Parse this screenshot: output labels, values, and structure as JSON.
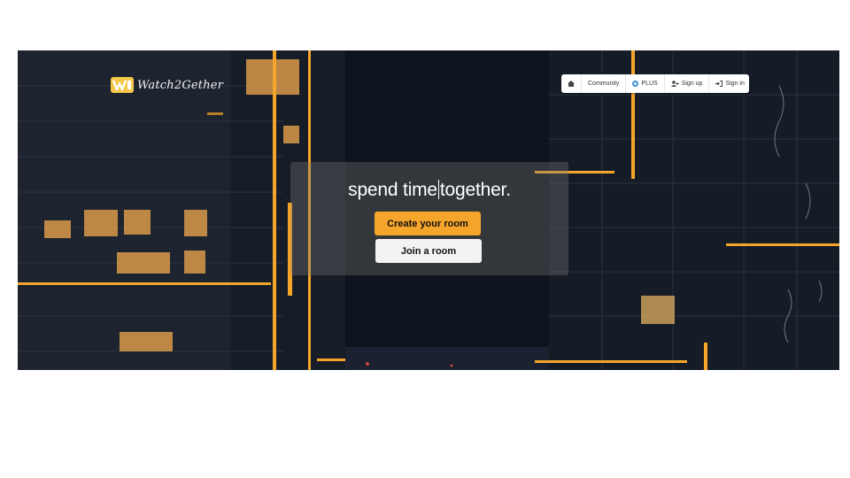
{
  "brand": {
    "name": "Watch2Gether",
    "accent": "#f5a52a"
  },
  "nav": {
    "items": [
      {
        "id": "home",
        "label": "",
        "icon": "home-icon"
      },
      {
        "id": "community",
        "label": "Community",
        "icon": ""
      },
      {
        "id": "plus",
        "label": "PLUS",
        "icon": "plus-badge-icon"
      },
      {
        "id": "signup",
        "label": "Sign up",
        "icon": "user-plus-icon"
      },
      {
        "id": "signin",
        "label": "Sign in",
        "icon": "sign-in-icon"
      }
    ]
  },
  "hero": {
    "tagline_before": "spend time",
    "tagline_after": "together.",
    "create_label": "Create your room",
    "join_label": "Join a room"
  },
  "colors": {
    "create_button": "#f5a52a",
    "join_button": "#f3f3f3",
    "nav_bg": "#ffffff"
  }
}
